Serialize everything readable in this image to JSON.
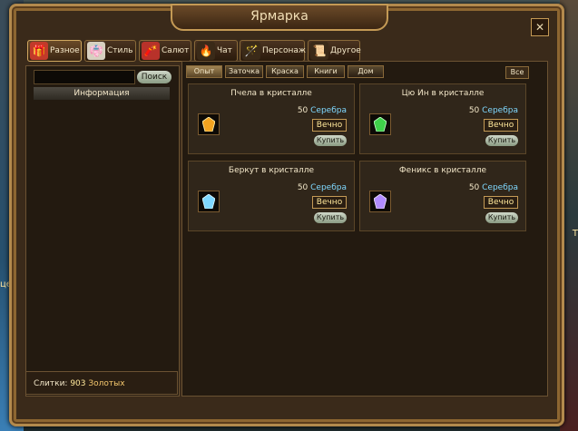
{
  "background": {
    "left_text": "цет",
    "right_text": "Т"
  },
  "window": {
    "title": "Ярмарка",
    "close_glyph": "✕"
  },
  "tabs": [
    {
      "label": "Разное",
      "icon": "gift-icon"
    },
    {
      "label": "Стиль",
      "icon": "outfit-icon"
    },
    {
      "label": "Салют",
      "icon": "firework-icon"
    },
    {
      "label": "Чат",
      "icon": "flame-icon"
    },
    {
      "label": "Персонаж",
      "icon": "wand-icon"
    },
    {
      "label": "Другое",
      "icon": "scroll-icon"
    }
  ],
  "sidebar": {
    "search_placeholder": "",
    "search_label": "Поиск",
    "info_label": "Информация"
  },
  "bullion": {
    "label": "Слитки:",
    "amount": "903",
    "currency": "Золотых"
  },
  "filters": [
    "Опыт",
    "Заточка",
    "Краска",
    "Книги",
    "Дом"
  ],
  "all_label": "Все",
  "items": [
    {
      "name": "Пчела в кристалле",
      "price": "50",
      "currency": "Серебра",
      "duration": "Вечно",
      "buy": "Купить",
      "gem_color": "#f2a320"
    },
    {
      "name": "Цю Ин в кристалле",
      "price": "50",
      "currency": "Серебра",
      "duration": "Вечно",
      "buy": "Купить",
      "gem_color": "#3fd04a"
    },
    {
      "name": "Беркут в кристалле",
      "price": "50",
      "currency": "Серебра",
      "duration": "Вечно",
      "buy": "Купить",
      "gem_color": "#7fd8ff"
    },
    {
      "name": "Феникс в кристалле",
      "price": "50",
      "currency": "Серебра",
      "duration": "Вечно",
      "buy": "Купить",
      "gem_color": "#b18cff"
    }
  ]
}
